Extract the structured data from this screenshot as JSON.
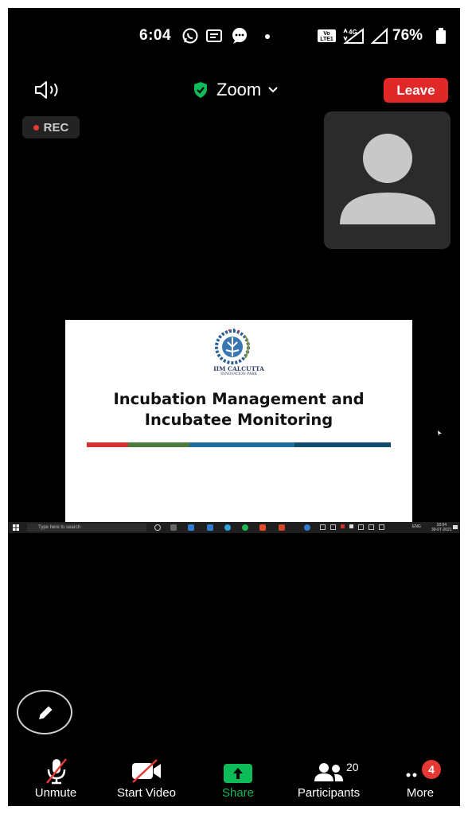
{
  "status_bar": {
    "time": "6:04",
    "network": "4G",
    "battery": "76%",
    "volte_label": "Vo\nLTE1"
  },
  "meeting": {
    "title": "Zoom",
    "leave_label": "Leave",
    "rec_label": "REC",
    "accent_color": "#0dbb59",
    "leave_color": "#e02828"
  },
  "shared_slide": {
    "logo_line1": "IIM CALCUTTA",
    "logo_line2": "INNOVATION PARK",
    "title_line1": "Incubation Management and",
    "title_line2": "Incubatee Monitoring",
    "stripe_colors": [
      "#d2312e",
      "#4c7c3d",
      "#1f6f9e",
      "#0f4c6e"
    ]
  },
  "shared_taskbar": {
    "search_placeholder": "Type here to search",
    "clock_time": "18:04",
    "clock_date": "30-07-2021",
    "lang": "ENG"
  },
  "bottom_bar": {
    "unmute_label": "Unmute",
    "video_label": "Start Video",
    "share_label": "Share",
    "participants_label": "Participants",
    "participants_count": "20",
    "more_label": "More",
    "more_badge": "4"
  }
}
